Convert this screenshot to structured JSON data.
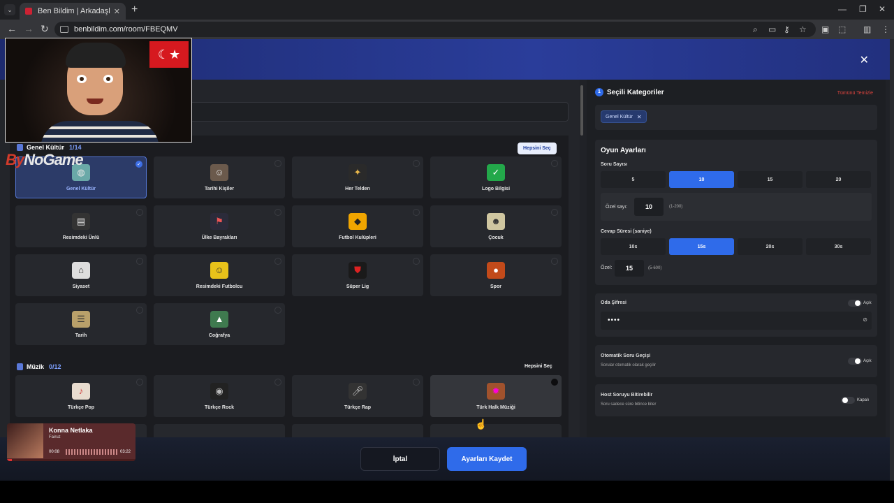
{
  "browser": {
    "tab_title": "Ben Bildim | Arkadaşlarınla Onl",
    "url": "benbildim.com/room/FBEQMV"
  },
  "modal": {
    "left": {
      "sections": [
        {
          "title": "Genel Kültür",
          "count": "1/14",
          "select_all": "Hepsini Seç",
          "cards": [
            "Genel Kültür",
            "Tarihi Kişiler",
            "Her Telden",
            "Logo Bilgisi",
            "Resimdeki Ünlü",
            "Ülke Bayrakları",
            "Futbol Kulüpleri",
            "Çocuk",
            "Siyaset",
            "Resimdeki Futbolcu",
            "Süper Lig",
            "Spor",
            "Tarih",
            "Coğrafya"
          ]
        },
        {
          "title": "Müzik",
          "count": "0/12",
          "select_all": "Hepsini Seç",
          "cards": [
            "Türkçe Pop",
            "Türkçe Rock",
            "Türkçe Rap",
            "Türk Halk Müziği"
          ]
        }
      ]
    },
    "right": {
      "selected_title": "Seçili Kategoriler",
      "selected_num": "1",
      "clear_all": "Tümünü Temizle",
      "chips": [
        "Genel Kültür"
      ],
      "game_settings": {
        "title": "Oyun Ayarları",
        "question_count_label": "Soru Sayısı",
        "question_counts": [
          "5",
          "10",
          "15",
          "20"
        ],
        "question_count_selected": "10",
        "custom_count_label": "Özel sayı:",
        "custom_count_value": "10",
        "custom_count_hint": "(1-200)",
        "answer_time_label": "Cevap Süresi (saniye)",
        "answer_times": [
          "10s",
          "15s",
          "20s",
          "30s"
        ],
        "answer_time_selected": "15s",
        "custom_time_label": "Özel:",
        "custom_time_value": "15",
        "custom_time_hint": "(5-600)"
      },
      "room_password": {
        "label": "Oda Şifresi",
        "state": "Açık",
        "value": "••••"
      },
      "auto_next": {
        "label": "Otomatik Soru Geçişi",
        "sub": "Sorular otomatik olarak geçilir",
        "state": "Açık"
      },
      "host_finish": {
        "label": "Host Soruyu Bitirebilir",
        "sub": "Soru sadece süre bitince biter",
        "state": "Kapalı"
      }
    },
    "footer": {
      "cancel": "İptal",
      "save": "Ayarları Kaydet"
    }
  },
  "overlay": {
    "logo_prefix": "By",
    "logo_rest": "NoGame",
    "player": {
      "track": "Konna Netlaka",
      "artist": "Fairuz",
      "elapsed": "00:08",
      "duration": "03:22",
      "progress": 0.04
    }
  }
}
